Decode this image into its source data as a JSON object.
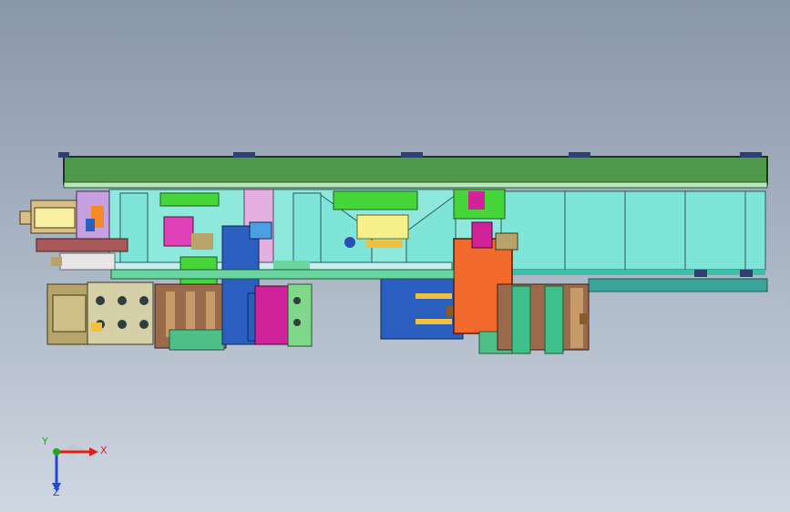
{
  "viewport": {
    "background_top": "#8a97a8",
    "background_bottom": "#cfd7e1"
  },
  "triad": {
    "x_label": "X",
    "y_label": "Y",
    "z_label": "Z",
    "x_color": "#e0211b",
    "y_color": "#1fa81f",
    "z_color": "#2348d6"
  },
  "model": {
    "colors": {
      "top_plate": "#4f9a4a",
      "frame_cyan": "#7fe5d8",
      "orange_block": "#f26a2b",
      "blue_block": "#2a5fc0",
      "magenta_block": "#d0239a",
      "green_block": "#47d63a",
      "tan_block": "#b8a46a",
      "brown_block": "#9a6a4a"
    }
  }
}
